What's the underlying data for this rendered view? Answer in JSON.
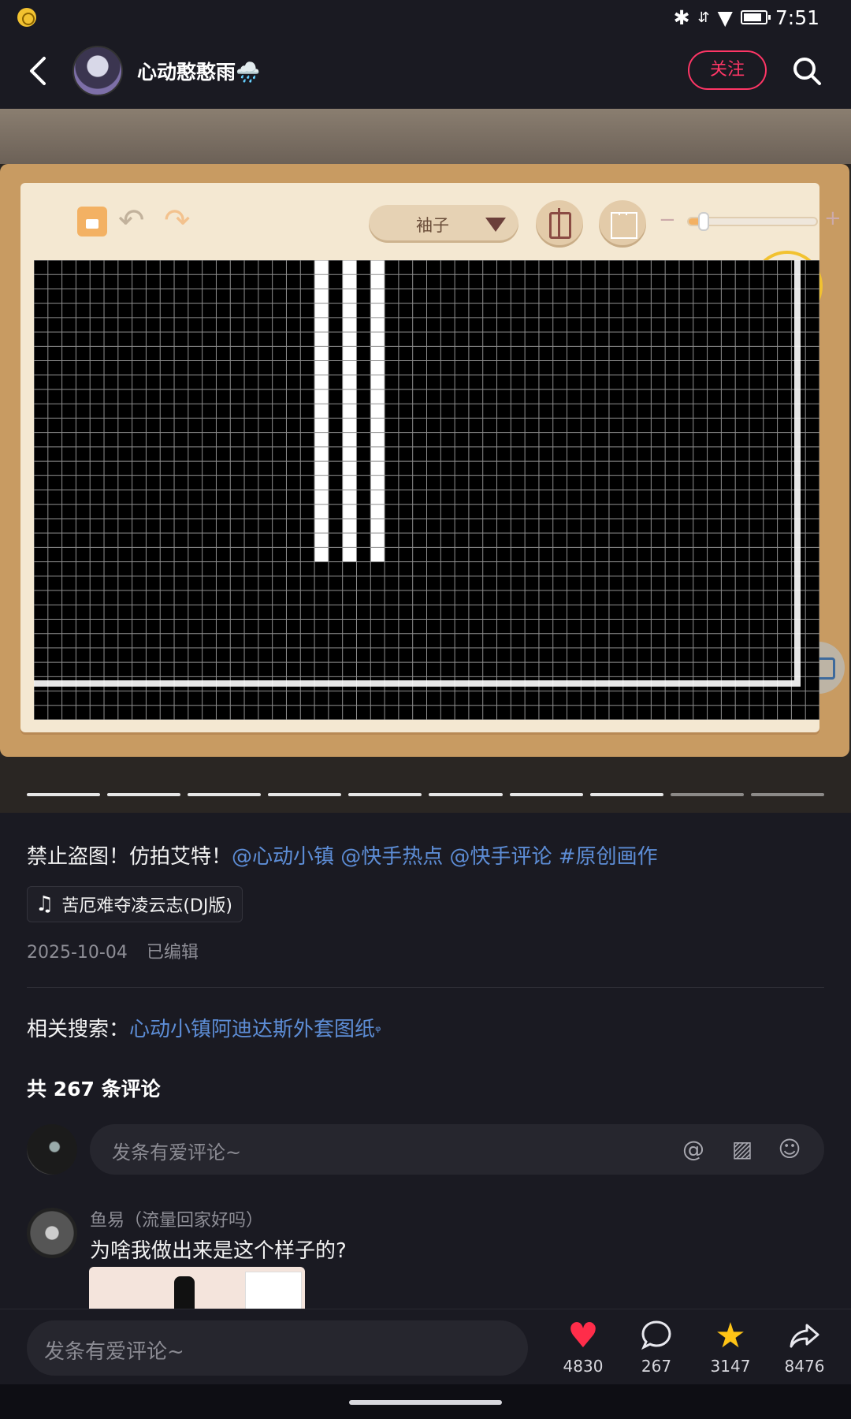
{
  "status_bar": {
    "time": "7:51",
    "bluetooth_icon": "bluetooth-icon",
    "signal_icon": "signal-icon",
    "wifi_icon": "wifi-icon",
    "battery_icon": "battery-icon"
  },
  "header": {
    "username": "心动憨憨雨🌧️",
    "follow_label": "关注"
  },
  "editor": {
    "part_select": "袖子",
    "zoom_level": 0.12,
    "grid": {
      "cols": 56,
      "rows": 32,
      "white_columns": [
        20,
        22,
        24
      ],
      "white_column_rows": [
        0,
        20
      ]
    }
  },
  "post": {
    "caption_text": "禁止盗图！仿拍艾特！",
    "caption_tags": "@心动小镇 @快手热点 @快手评论 #原创画作",
    "music": "苦厄难夺凌云志(DJ版)",
    "date": "2025-10-04",
    "edited": "已编辑",
    "related_label": "相关搜索：",
    "related_link": "心动小镇阿迪达斯外套图纸",
    "progress_total": 10,
    "progress_filled": 8
  },
  "comments": {
    "count_text": "共 267 条评论",
    "input_placeholder": "发条有爱评论~",
    "items": [
      {
        "user": "鱼易（流量回家好吗）",
        "text": "为啥我做出来是这个样子的?"
      }
    ]
  },
  "bottom_bar": {
    "input_placeholder": "发条有爱评论~",
    "likes": "4830",
    "comments": "267",
    "favorites": "3147",
    "shares": "8476"
  },
  "colors": {
    "accent_pink": "#fe3666",
    "link_blue": "#5d8dd6",
    "like_red": "#ff2d4a",
    "star_yellow": "#ffc416",
    "background": "#1a1a22"
  }
}
